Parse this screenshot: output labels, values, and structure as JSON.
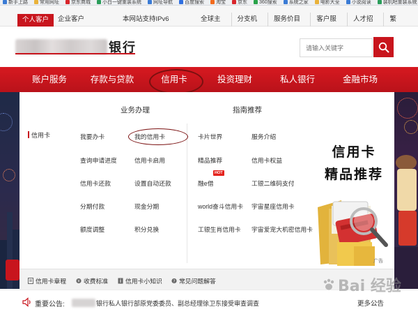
{
  "browser": {
    "bookmarks": [
      {
        "label": "新手上路",
        "icon": "bookmark-icon",
        "color": "#3a7bd5"
      },
      {
        "label": "常用网址",
        "icon": "folder-icon",
        "color": "#e9b23a"
      },
      {
        "label": "京东商城",
        "icon": "jd-icon",
        "color": "#d8252b"
      },
      {
        "label": "小白一键重装系统",
        "icon": "app-icon",
        "color": "#2a9d5a"
      },
      {
        "label": "网址导航",
        "icon": "nav-icon",
        "color": "#3a7bd5"
      },
      {
        "label": "百度搜索",
        "icon": "search-icon",
        "color": "#2f6fe0"
      },
      {
        "label": "淘宝",
        "icon": "taobao-icon",
        "color": "#f26b1d"
      },
      {
        "label": "京东",
        "icon": "jd-icon",
        "color": "#d8252b"
      },
      {
        "label": "360搜索",
        "icon": "search-icon",
        "color": "#2aa34a"
      },
      {
        "label": "系统之家",
        "icon": "app-icon",
        "color": "#3a7bd5"
      },
      {
        "label": "电影大全",
        "icon": "film-icon",
        "color": "#e9b23a"
      },
      {
        "label": "小说阅读",
        "icon": "book-icon",
        "color": "#3a7bd5"
      },
      {
        "label": "装机吧重装系统",
        "icon": "app-icon",
        "color": "#2a9d5a"
      }
    ]
  },
  "topbar": {
    "personal": "个人客户",
    "enterprise": "企业客户",
    "ipv6": "本网站支持IPv6",
    "links": [
      "全球主站",
      "分支机构",
      "服务价目表",
      "客户服务",
      "人才招聘",
      "繁体/EN"
    ]
  },
  "header": {
    "logo_text": "银行",
    "search_placeholder": "请输入关键字"
  },
  "nav": {
    "items": [
      "账户服务",
      "存款与贷款",
      "信用卡",
      "投资理财",
      "私人银行",
      "金融市场"
    ],
    "active": "信用卡"
  },
  "panel": {
    "col1_title": "业务办理",
    "col2_title": "指南推荐",
    "category": "信用卡",
    "business_links": [
      "我要办卡",
      "我的信用卡",
      "查询申请进度",
      "信用卡启用",
      "信用卡还款",
      "设置自动还款",
      "分期付款",
      "现金分期",
      "额度调整",
      "积分兑换"
    ],
    "guide_links": [
      "卡片世界",
      "服务介绍",
      "精品推荐",
      "信用卡权益",
      "融e借",
      "工银二维码支付",
      "world奋斗信用卡",
      "宇宙星座信用卡",
      "工银生肖信用卡",
      "宇宙爱宠大机密信用卡"
    ],
    "hot_badge": "HOT",
    "promo_line1": "信用卡",
    "promo_line2": "精品推荐",
    "promo_ad": "广告",
    "brand_color": "#c8151d"
  },
  "bottom_links": [
    {
      "label": "信用卡章程",
      "icon": "document-icon"
    },
    {
      "label": "收费标准",
      "icon": "coin-icon"
    },
    {
      "label": "信用卡小知识",
      "icon": "info-icon"
    },
    {
      "label": "常见问题解答",
      "icon": "question-icon"
    }
  ],
  "announcement": {
    "label": "重要公告:",
    "text": "银行私人银行部原党委委员、副总经理徐卫东接受审查调查",
    "more": "更多公告"
  },
  "watermark": {
    "text": "Bai 经验"
  }
}
